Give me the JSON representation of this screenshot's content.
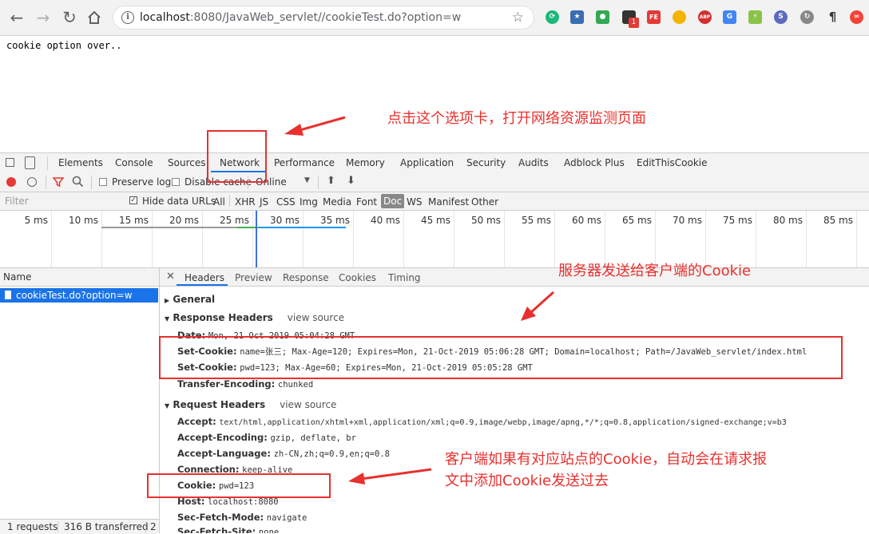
{
  "browser": {
    "url_host": "localhost",
    "url_rest": ":8080/JavaWeb_servlet//cookieTest.do?option=w",
    "ext_labels": [
      "1",
      "FE",
      "ABP"
    ]
  },
  "page": {
    "text": "cookie option over.."
  },
  "devtools": {
    "tabs": [
      "Elements",
      "Console",
      "Sources",
      "Network",
      "Performance",
      "Memory",
      "Application",
      "Security",
      "Audits",
      "Adblock Plus",
      "EditThisCookie"
    ],
    "toolbar": {
      "preserve_log": "Preserve log",
      "disable_cache": "Disable cache",
      "throttle": "Online"
    },
    "filter": {
      "placeholder": "Filter",
      "hide_data_urls": "Hide data URLs",
      "types": [
        "All",
        "XHR",
        "JS",
        "CSS",
        "Img",
        "Media",
        "Font",
        "Doc",
        "WS",
        "Manifest",
        "Other"
      ],
      "active_type": "Doc"
    },
    "timeline_ticks": [
      "5 ms",
      "10 ms",
      "15 ms",
      "20 ms",
      "25 ms",
      "30 ms",
      "35 ms",
      "40 ms",
      "45 ms",
      "50 ms",
      "55 ms",
      "60 ms",
      "65 ms",
      "70 ms",
      "75 ms",
      "80 ms",
      "85 ms"
    ],
    "name_header": "Name",
    "request": "cookieTest.do?option=w",
    "detail_tabs": [
      "Headers",
      "Preview",
      "Response",
      "Cookies",
      "Timing"
    ],
    "general": "General",
    "response_headers": {
      "title": "Response Headers",
      "view_source": "view source",
      "lines": [
        {
          "k": "Date:",
          "v": "Mon, 21 Oct 2019 05:04:28 GMT"
        },
        {
          "k": "Set-Cookie:",
          "v": "name=张三; Max-Age=120; Expires=Mon, 21-Oct-2019 05:06:28 GMT; Domain=localhost; Path=/JavaWeb_servlet/index.html"
        },
        {
          "k": "Set-Cookie:",
          "v": "pwd=123; Max-Age=60; Expires=Mon, 21-Oct-2019 05:05:28 GMT"
        },
        {
          "k": "Transfer-Encoding:",
          "v": "chunked"
        }
      ]
    },
    "request_headers": {
      "title": "Request Headers",
      "view_source": "view source",
      "lines": [
        {
          "k": "Accept:",
          "v": "text/html,application/xhtml+xml,application/xml;q=0.9,image/webp,image/apng,*/*;q=0.8,application/signed-exchange;v=b3"
        },
        {
          "k": "Accept-Encoding:",
          "v": "gzip, deflate, br"
        },
        {
          "k": "Accept-Language:",
          "v": "zh-CN,zh;q=0.9,en;q=0.8"
        },
        {
          "k": "Connection:",
          "v": "keep-alive"
        },
        {
          "k": "Cookie:",
          "v": "pwd=123"
        },
        {
          "k": "Host:",
          "v": "localhost:8080"
        },
        {
          "k": "Sec-Fetch-Mode:",
          "v": "navigate"
        },
        {
          "k": "Sec-Fetch-Site:",
          "v": "none"
        }
      ]
    },
    "status": {
      "requests": "1 requests",
      "transferred": "316 B transferred",
      "more": "2"
    }
  },
  "annotations": {
    "note1": "点击这个选项卡，打开网络资源监测页面",
    "note2": "服务器发送给客户端的Cookie",
    "note3_line1": "客户端如果有对应站点的Cookie，自动会在请求报",
    "note3_line2": "文中添加Cookie发送过去"
  },
  "colors": {
    "annotation": "#e8302e",
    "selection": "#1a73e8"
  }
}
